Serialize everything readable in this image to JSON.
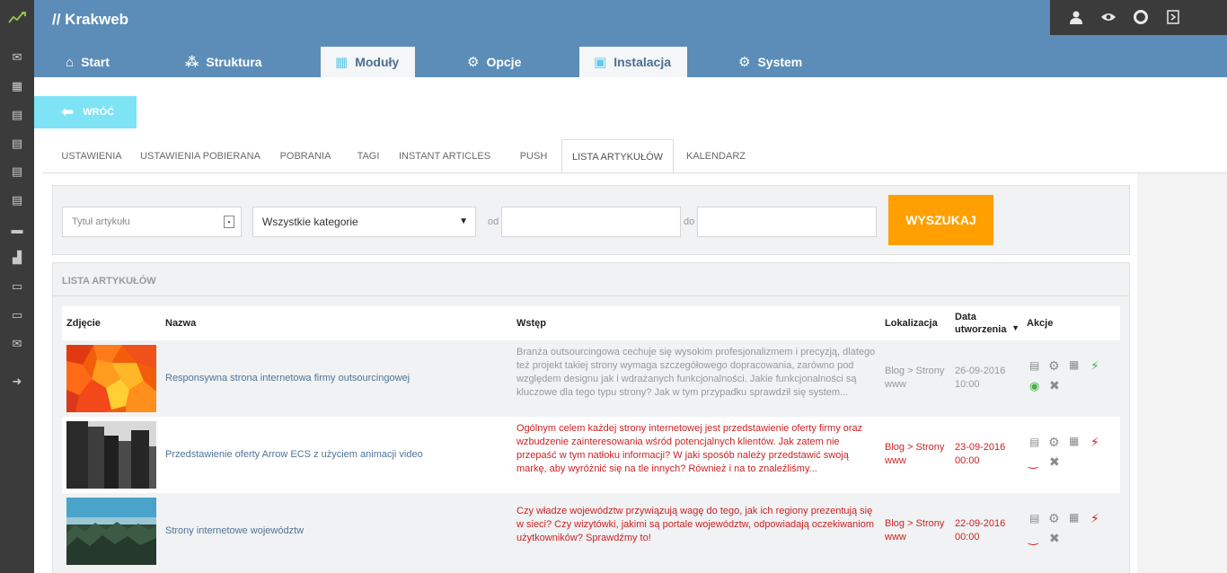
{
  "app": {
    "brand": "// Krakweb",
    "logo_icon": "trend-line-icon"
  },
  "rail": {
    "icons": [
      "envelope-icon",
      "grid-icon",
      "document-icon",
      "document-icon",
      "document-icon",
      "document-icon",
      "list-icon",
      "stamp-icon",
      "monitor-icon",
      "monitor-icon",
      "envelope-icon",
      "arrow-right-icon"
    ]
  },
  "toolbar_icons": [
    "user-icon",
    "eye-icon",
    "lifebuoy-icon",
    "exit-icon"
  ],
  "main_tabs": [
    {
      "label": "Start",
      "icon": "home-icon",
      "active": false
    },
    {
      "label": "Struktura",
      "icon": "sitemap-icon",
      "active": false
    },
    {
      "label": "Moduły",
      "icon": "modules-icon",
      "active": true
    },
    {
      "label": "Opcje",
      "icon": "gear-icon",
      "active": false
    },
    {
      "label": "Instalacja",
      "icon": "chip-icon",
      "active": true
    },
    {
      "label": "System",
      "icon": "gear-icon",
      "active": false
    }
  ],
  "back_label": "WRÓĆ",
  "sub_tabs": [
    {
      "label": "USTAWIENIA",
      "active": false
    },
    {
      "label": "USTAWIENIA POBIERANA",
      "active": false
    },
    {
      "label": "POBRANIA",
      "active": false
    },
    {
      "label": "TAGI",
      "active": false
    },
    {
      "label": "INSTANT ARTICLES",
      "active": false
    },
    {
      "label": "PUSH",
      "active": false
    },
    {
      "label": "LISTA ARTYKUŁÓW",
      "active": true
    },
    {
      "label": "KALENDARZ",
      "active": false
    }
  ],
  "filters": {
    "title_placeholder": "Tytuł artykułu",
    "category_value": "Wszystkie kategorie",
    "from_label": "od",
    "to_label": "do",
    "search_label": "WYSZUKAJ"
  },
  "list": {
    "heading": "LISTA ARTYKUŁÓW",
    "columns": {
      "photo": "Zdjęcie",
      "name": "Nazwa",
      "intro": "Wstęp",
      "location": "Lokalizacja",
      "date": "Data utworzenia",
      "actions": "Akcje"
    },
    "rows": [
      {
        "name": "Responsywna strona internetowa firmy outsourcingowej",
        "intro": "Branża outsourcingowa cechuje się wysokim profesjonalizmem i precyzją, dlatego też projekt takiej strony wymaga szczegółowego dopracowania, zarówno pod względem designu jak i wdrażanych funkcjonalności. Jakie funkcjonalności są kluczowe dla tego typu strony? Jak w tym przypadku sprawdził się system...",
        "location": "Blog > Strony www",
        "date": "26-09-2016 10:00",
        "status": "published",
        "plug_color": "#46b246",
        "eye_icon": "eye-open-icon"
      },
      {
        "name": "Przedstawienie oferty Arrow ECS z użyciem animacji video",
        "intro": "Ogólnym celem każdej strony internetowej jest przedstawienie oferty firmy oraz wzbudzenie zainteresowania wśród potencjalnych klientów. Jak zatem nie przepaść w tym natłoku informacji? W jaki sposób należy przedstawić swoją markę, aby wyróżnić się na tle innych? Również i na to znaleźliśmy...",
        "location": "Blog > Strony www",
        "date": "23-09-2016 00:00",
        "status": "unpublished",
        "plug_color": "#cc2222",
        "eye_icon": "eye-closed-icon"
      },
      {
        "name": "Strony internetowe województw",
        "intro": "Czy władze województw przywiązują wagę do tego, jak ich regiony prezentują się w sieci? Czy wizytówki, jakimi są portale województw, odpowiadają oczekiwaniom użytkowników? Sprawdźmy to!",
        "location": "Blog > Strony www",
        "date": "22-09-2016 00:00",
        "status": "unpublished",
        "plug_color": "#cc2222",
        "eye_icon": "eye-closed-icon"
      }
    ]
  }
}
